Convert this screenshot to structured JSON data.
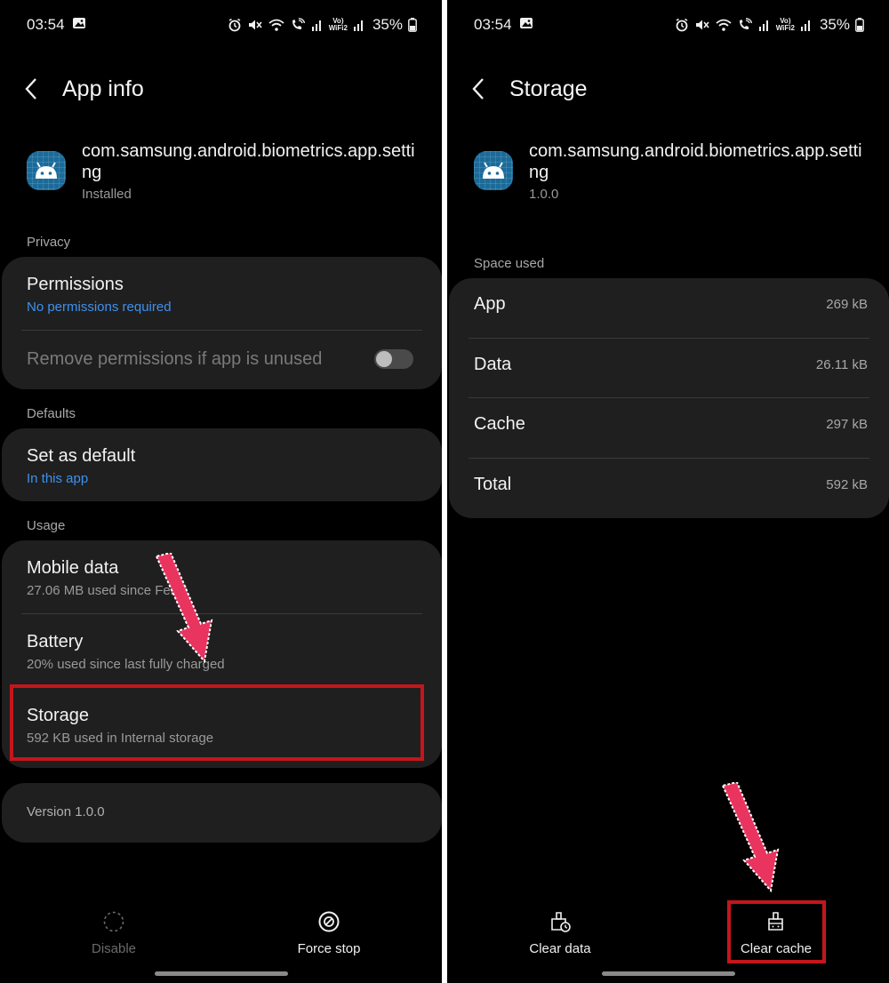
{
  "left": {
    "status": {
      "time": "03:54",
      "battery": "35%"
    },
    "header": {
      "title": "App info"
    },
    "app": {
      "name": "com.samsung.android.biometrics.app.setting",
      "status": "Installed"
    },
    "privacy": {
      "label": "Privacy",
      "permissions_title": "Permissions",
      "permissions_sub": "No permissions required",
      "remove_unused_label": "Remove permissions if app is unused"
    },
    "defaults": {
      "label": "Defaults",
      "set_default_title": "Set as default",
      "set_default_sub": "In this app"
    },
    "usage": {
      "label": "Usage",
      "mobile_title": "Mobile data",
      "mobile_sub": "27.06 MB used since Feb 1",
      "battery_title": "Battery",
      "battery_sub": "20% used since last fully charged",
      "storage_title": "Storage",
      "storage_sub": "592 KB used in Internal storage"
    },
    "version": "Version 1.0.0",
    "bottom": {
      "disable_label": "Disable",
      "force_stop_label": "Force stop"
    }
  },
  "right": {
    "status": {
      "time": "03:54",
      "battery": "35%"
    },
    "header": {
      "title": "Storage"
    },
    "app": {
      "name": "com.samsung.android.biometrics.app.setting",
      "version": "1.0.0"
    },
    "space_used": {
      "label": "Space used",
      "rows": [
        {
          "label": "App",
          "value": "269 kB"
        },
        {
          "label": "Data",
          "value": "26.11 kB"
        },
        {
          "label": "Cache",
          "value": "297 kB"
        },
        {
          "label": "Total",
          "value": "592 kB"
        }
      ]
    },
    "bottom": {
      "clear_data_label": "Clear data",
      "clear_cache_label": "Clear cache"
    }
  },
  "colors": {
    "background": "#000000",
    "card": "#1f1f1f",
    "link_blue": "#3e91ef",
    "highlight_red": "#c4161c",
    "arrow_pink": "#e8345e"
  },
  "icons": [
    "back-arrow-icon",
    "android-app-icon",
    "alarm-icon",
    "mute-icon",
    "wifi-icon",
    "wifi-calling-icon",
    "signal-icon",
    "volte-icon",
    "battery-icon",
    "gallery-icon",
    "disable-icon",
    "force-stop-icon",
    "clear-data-icon",
    "clear-cache-icon",
    "pointer-arrow-icon"
  ]
}
